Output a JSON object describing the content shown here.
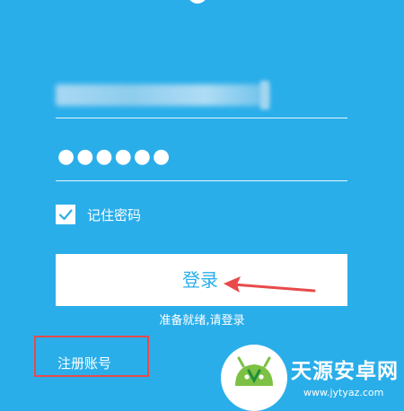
{
  "login": {
    "username_value": "",
    "password_dots": "●●●●●●",
    "remember_label": "记住密码",
    "remember_checked": true,
    "login_label": "登录",
    "status_text": "准备就绪,请登录",
    "register_label": "注册账号"
  },
  "watermark": {
    "title": "天源安卓网",
    "url": "www.jytyaz.com"
  },
  "colors": {
    "background": "#2aaeea",
    "highlight": "#e84a4a"
  }
}
